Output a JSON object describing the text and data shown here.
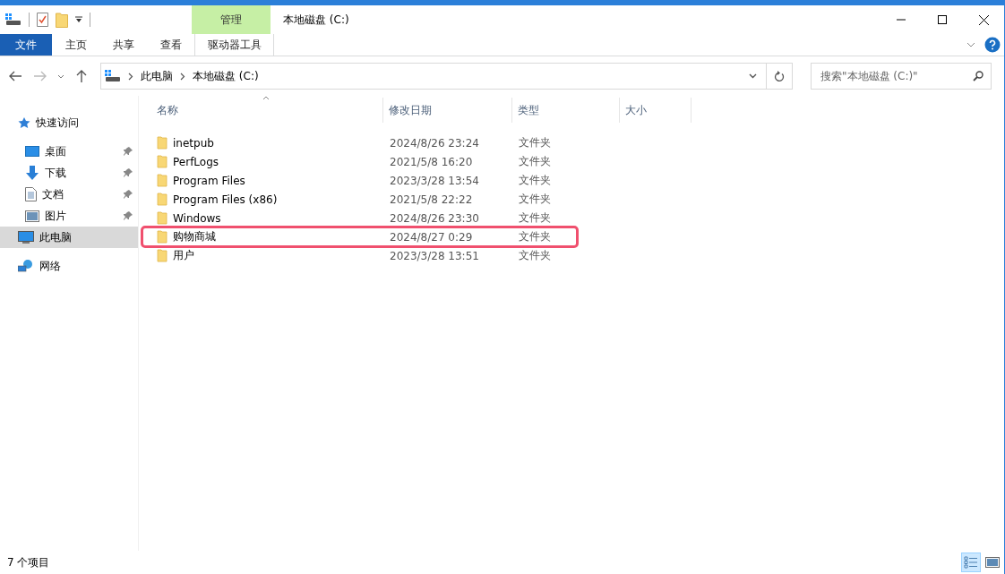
{
  "window": {
    "title": "本地磁盘 (C:)"
  },
  "ribbon": {
    "context_group": "管理",
    "tabs": [
      {
        "label": "文件",
        "kind": "file",
        "selected": false
      },
      {
        "label": "主页",
        "kind": "tab",
        "selected": false
      },
      {
        "label": "共享",
        "kind": "tab",
        "selected": false
      },
      {
        "label": "查看",
        "kind": "tab",
        "selected": false
      },
      {
        "label": "驱动器工具",
        "kind": "context",
        "selected": false
      }
    ]
  },
  "address": {
    "path": [
      "此电脑",
      "本地磁盘 (C:)"
    ]
  },
  "search": {
    "placeholder": "搜索\"本地磁盘 (C:)\""
  },
  "nav": [
    {
      "label": "快速访问",
      "kind": "star",
      "pinned": false,
      "selected": false,
      "children": [
        {
          "label": "桌面",
          "kind": "desktop",
          "pinned": true,
          "selected": false
        },
        {
          "label": "下载",
          "kind": "download",
          "pinned": true,
          "selected": false
        },
        {
          "label": "文档",
          "kind": "document",
          "pinned": true,
          "selected": false
        },
        {
          "label": "图片",
          "kind": "picture",
          "pinned": true,
          "selected": false
        }
      ]
    },
    {
      "label": "此电脑",
      "kind": "computer",
      "pinned": false,
      "selected": true
    },
    {
      "label": "网络",
      "kind": "network",
      "pinned": false,
      "selected": false
    }
  ],
  "table": {
    "columns": [
      "名称",
      "修改日期",
      "类型",
      "大小"
    ],
    "rows": [
      {
        "name": "inetpub",
        "modified": "2024/8/26 23:24",
        "type": "文件夹",
        "highlighted": false
      },
      {
        "name": "PerfLogs",
        "modified": "2021/5/8 16:20",
        "type": "文件夹",
        "highlighted": false
      },
      {
        "name": "Program Files",
        "modified": "2023/3/28 13:54",
        "type": "文件夹",
        "highlighted": false
      },
      {
        "name": "Program Files (x86)",
        "modified": "2021/5/8 22:22",
        "type": "文件夹",
        "highlighted": false
      },
      {
        "name": "Windows",
        "modified": "2024/8/26 23:30",
        "type": "文件夹",
        "highlighted": false
      },
      {
        "name": "购物商城",
        "modified": "2024/8/27 0:29",
        "type": "文件夹",
        "highlighted": true
      },
      {
        "name": "用户",
        "modified": "2023/3/28 13:51",
        "type": "文件夹",
        "highlighted": false
      }
    ]
  },
  "status_bar": {
    "count": "7 个项目",
    "views": [
      {
        "kind": "details",
        "selected": true
      },
      {
        "kind": "large",
        "selected": false
      }
    ]
  }
}
